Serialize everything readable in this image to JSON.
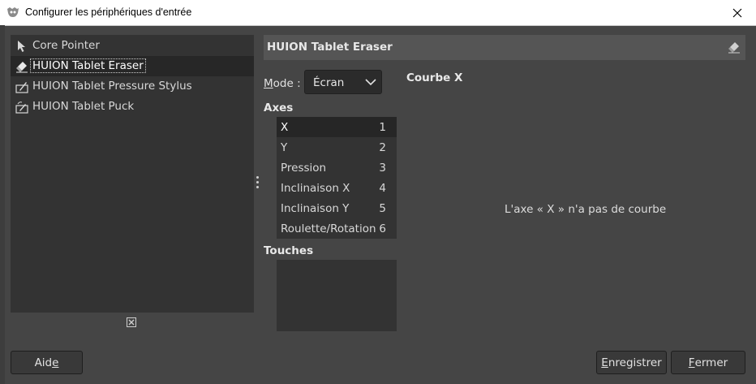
{
  "window": {
    "title": "Configurer les périphériques d'entrée",
    "app_icon": "gimp-icon",
    "close_icon": "close-icon"
  },
  "devices": [
    {
      "label": "Core Pointer",
      "icon": "pointer-icon",
      "selected": false
    },
    {
      "label": "HUION Tablet Eraser",
      "icon": "eraser-icon",
      "selected": true
    },
    {
      "label": "HUION Tablet Pressure Stylus",
      "icon": "tablet-stylus-icon",
      "selected": false
    },
    {
      "label": "HUION Tablet Puck",
      "icon": "tablet-puck-icon",
      "selected": false
    }
  ],
  "device_panel": {
    "header_title": "HUION Tablet Eraser",
    "header_icon": "eraser-icon",
    "mode_label_prefix": "M",
    "mode_label_rest": "ode :",
    "mode_value": "Écran",
    "axes_label": "Axes",
    "axes": [
      {
        "name": "X",
        "num": "1",
        "selected": true
      },
      {
        "name": "Y",
        "num": "2",
        "selected": false
      },
      {
        "name": "Pression",
        "num": "3",
        "selected": false
      },
      {
        "name": "Inclinaison X",
        "num": "4",
        "selected": false
      },
      {
        "name": "Inclinaison Y",
        "num": "5",
        "selected": false
      },
      {
        "name": "Roulette/Rotation",
        "num": "6",
        "selected": false
      }
    ],
    "keys_label": "Touches",
    "curve_title": "Courbe X",
    "curve_message": "L'axe « X » n'a pas de courbe"
  },
  "buttons": {
    "help_a": "Aid",
    "help_b": "e",
    "save_a": "E",
    "save_b": "nregistrer",
    "close_a": "F",
    "close_b": "ermer"
  },
  "colors": {
    "background": "#454545",
    "list_bg": "#333333",
    "selected_bg": "#272727",
    "header_bg": "#555555"
  }
}
